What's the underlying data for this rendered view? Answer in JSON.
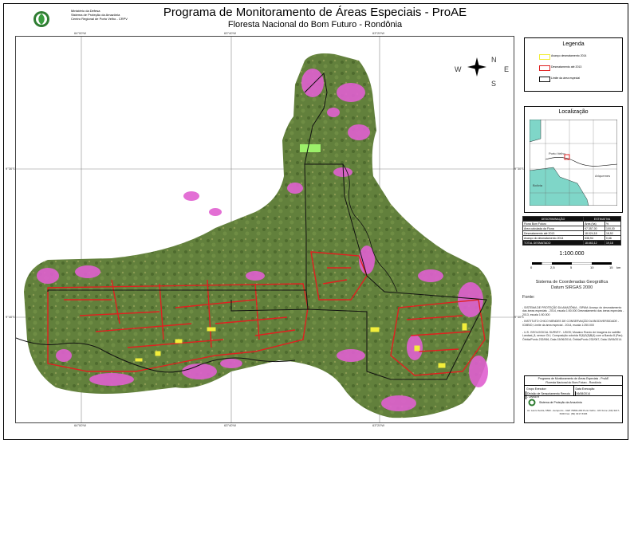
{
  "header": {
    "org_lines": [
      "Ministério da Defesa",
      "Sistema de Proteção da Amazônia",
      "Centro Regional de Porto Velho - CRPV"
    ],
    "title": "Programa de Monitoramento de Áreas Especiais - ProAE",
    "subtitle": "Floresta Nacional do Bom Futuro - Rondônia"
  },
  "map": {
    "coords_top": [
      "64°00'W",
      "63°40'W",
      "63°20'W"
    ],
    "coords_bottom": [
      "64°00'W",
      "63°40'W",
      "63°20'W"
    ],
    "coords_left": [
      "9°30'S",
      "9°40'S"
    ],
    "coords_right": [
      "9°30'S",
      "9°40'S"
    ],
    "north_arrow": {
      "n": "N",
      "s": "S",
      "e": "E",
      "w": "W"
    },
    "colors": {
      "forest": "#5f7a3a",
      "deforested": "#e060d0",
      "recent": "#f2ee3a",
      "until_2013": "#e02020",
      "boundary": "#111111"
    }
  },
  "legend": {
    "title": "Legenda",
    "items": [
      {
        "label": "Avanço desmatamento 2014",
        "color": "#f2ee3a"
      },
      {
        "label": "Desmatamento até 2013",
        "color": "#e02020"
      },
      {
        "label": "Limite da área especial",
        "color": "#111111"
      }
    ]
  },
  "location": {
    "title": "Localização",
    "labels": [
      "Porto Velho",
      "Ariquemes",
      "Bolívia"
    ]
  },
  "stats": {
    "headers": [
      "DESCRIMINAÇÃO",
      "ESTIMATIVA"
    ],
    "subheaders": [
      "Flona Bom Futuro",
      "Área (ha)",
      "%"
    ],
    "rows": [
      [
        "Área calculada da Flona",
        "97.357,00",
        "100,00"
      ],
      [
        "Desmatamento até 2013",
        "18.024,18",
        "18,52"
      ],
      [
        "Avanço do desmatamento 2014",
        "638,94",
        "0,66"
      ]
    ],
    "total": [
      "TOTAL DESMATADO",
      "18.663,12",
      "19,18"
    ]
  },
  "scale": {
    "text": "1:100.000",
    "ticks": [
      "0",
      "2,5",
      "5",
      "10",
      "15",
      "km"
    ]
  },
  "crs": {
    "line1": "Sistema de Coordenadas Geográfica",
    "line2": "Datum SIRGAS 2000"
  },
  "sources": {
    "heading": "Fonte:",
    "entries": [
      "- SISTEMA DE PROTEÇÃO DA AMAZÔNIA - SIPAM; Avanço do desmatamento das áreas especiais - 2014, escala 1:50.000 Desmatamento das áreas especiais - 2013, escala 1:50.000",
      "- INSTITUTO CHICO MENDES DE CONSERVAÇÃO DA BIODIVERSIDADE - ICMBIO; Limite da área especial - 2014, escala 1:250.000",
      "- U.S. GEOLOGICAL SURVEY - USGS; Mosaico Rondo de imagens do satélite Landsat_8, sensor OLI, Composição colorida R(6)G(5)B(4) com a Banda 8 (Pan). Órbita/Ponto 232/066, Data 15/06/2014; Órbita/Ponto 232/067, Data 15/06/2014."
    ]
  },
  "titleblock": {
    "line1": "Programa de Monitoramento de Áreas Especiais - ProAE",
    "line2": "Floresta Nacional do Bom Futuro - Rondônia",
    "author_label": "Grupo Executor:",
    "author": "Divisão de Sensoriamento Remoto - DiviSER",
    "date_label": "Data Execução:",
    "date": "06/08/2014",
    "logo_text": "Sistema de Proteção da Amazônia",
    "footer": "Av. Lauro Sodré, 6500 - Aeroporto - CEP 76803-260 Porto Velho - RO  Fone: (69) 3217-6300  Fax: (69) 3217-6336"
  }
}
